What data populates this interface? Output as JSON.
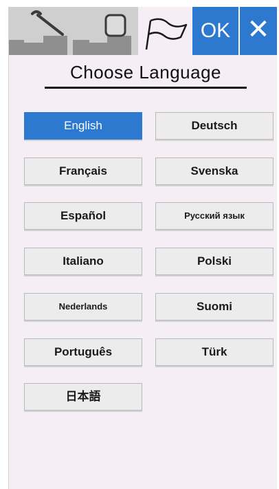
{
  "toolbar": {
    "ok_label": "OK",
    "close_label": "✕",
    "icons": [
      "wrench-icon",
      "page-icon",
      "flag-icon"
    ]
  },
  "title": "Choose Language",
  "languages": {
    "left": [
      "English",
      "Français",
      "Español",
      "Italiano",
      "Nederlands",
      "Português",
      "日本語"
    ],
    "right": [
      "Deutsch",
      "Svenska",
      "Русский язык",
      "Polski",
      "Suomi",
      "Türk"
    ]
  },
  "selected_language": "English",
  "colors": {
    "accent": "#2d79cf",
    "background": "#f6eef5",
    "button": "#ececec"
  }
}
